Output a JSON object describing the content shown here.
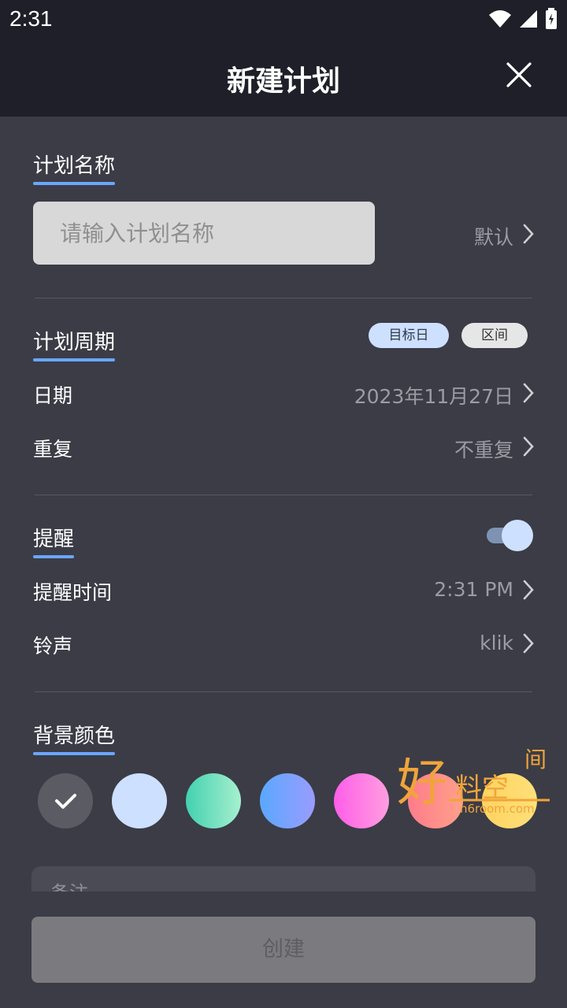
{
  "status_bar": {
    "time": "2:31"
  },
  "header": {
    "title": "新建计划"
  },
  "plan_name": {
    "label": "计划名称",
    "placeholder": "请输入计划名称",
    "default_label": "默认"
  },
  "period": {
    "label": "计划周期",
    "chips": [
      "目标日",
      "区间"
    ],
    "date_label": "日期",
    "date_value": "2023年11月27日",
    "repeat_label": "重复",
    "repeat_value": "不重复"
  },
  "reminder": {
    "label": "提醒",
    "enabled": true,
    "time_label": "提醒时间",
    "time_value": "2:31 PM",
    "ringtone_label": "铃声",
    "ringtone_value": "klik"
  },
  "background": {
    "label": "背景颜色",
    "selected_index": 0,
    "colors": [
      "#5a5b63",
      "#cde0ff",
      "#55d3b8",
      "#6aa6ff",
      "#ff77e6",
      "#ff8a8a",
      "#ffd66b"
    ]
  },
  "note": {
    "placeholder": "备注"
  },
  "create_button": {
    "label": "创建"
  },
  "watermark": {
    "text_main": "好",
    "text_mid": "料空",
    "text_top": "间",
    "url": "n6room.com"
  },
  "icons": [
    "wifi-icon",
    "signal-icon",
    "battery-icon",
    "close-icon",
    "chevron-right-icon",
    "check-icon"
  ]
}
